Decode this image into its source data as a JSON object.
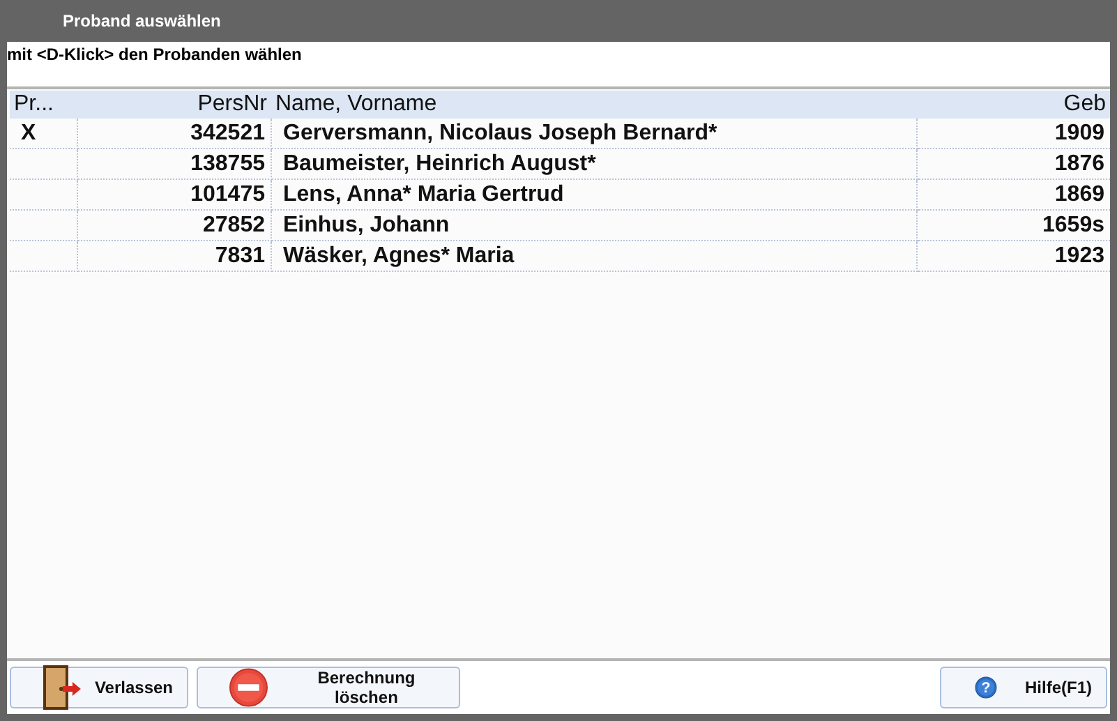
{
  "window": {
    "title": "Proband auswählen"
  },
  "instruction": "mit <D-Klick> den Probanden wählen",
  "table": {
    "columns": [
      "Pr...",
      "PersNr",
      "Name, Vorname",
      "Geb"
    ],
    "rows": [
      {
        "cells": [
          "X",
          "342521",
          "Gerversmann, Nicolaus Joseph Bernard*",
          "1909"
        ]
      },
      {
        "cells": [
          "",
          "138755",
          "Baumeister, Heinrich August*",
          "1876"
        ]
      },
      {
        "cells": [
          "",
          "101475",
          "Lens, Anna* Maria Gertrud",
          "1869"
        ]
      },
      {
        "cells": [
          "",
          "27852",
          "Einhus, Johann",
          "1659s"
        ]
      },
      {
        "cells": [
          "",
          "7831",
          "Wäsker, Agnes* Maria",
          "1923"
        ]
      }
    ]
  },
  "buttons": [
    {
      "label": "Verlassen",
      "kind": "exit"
    },
    {
      "label": "Berechnung löschen",
      "kind": "delete"
    },
    {
      "label": "Hilfe(F1)",
      "kind": "help",
      "glyph": "?"
    }
  ]
}
